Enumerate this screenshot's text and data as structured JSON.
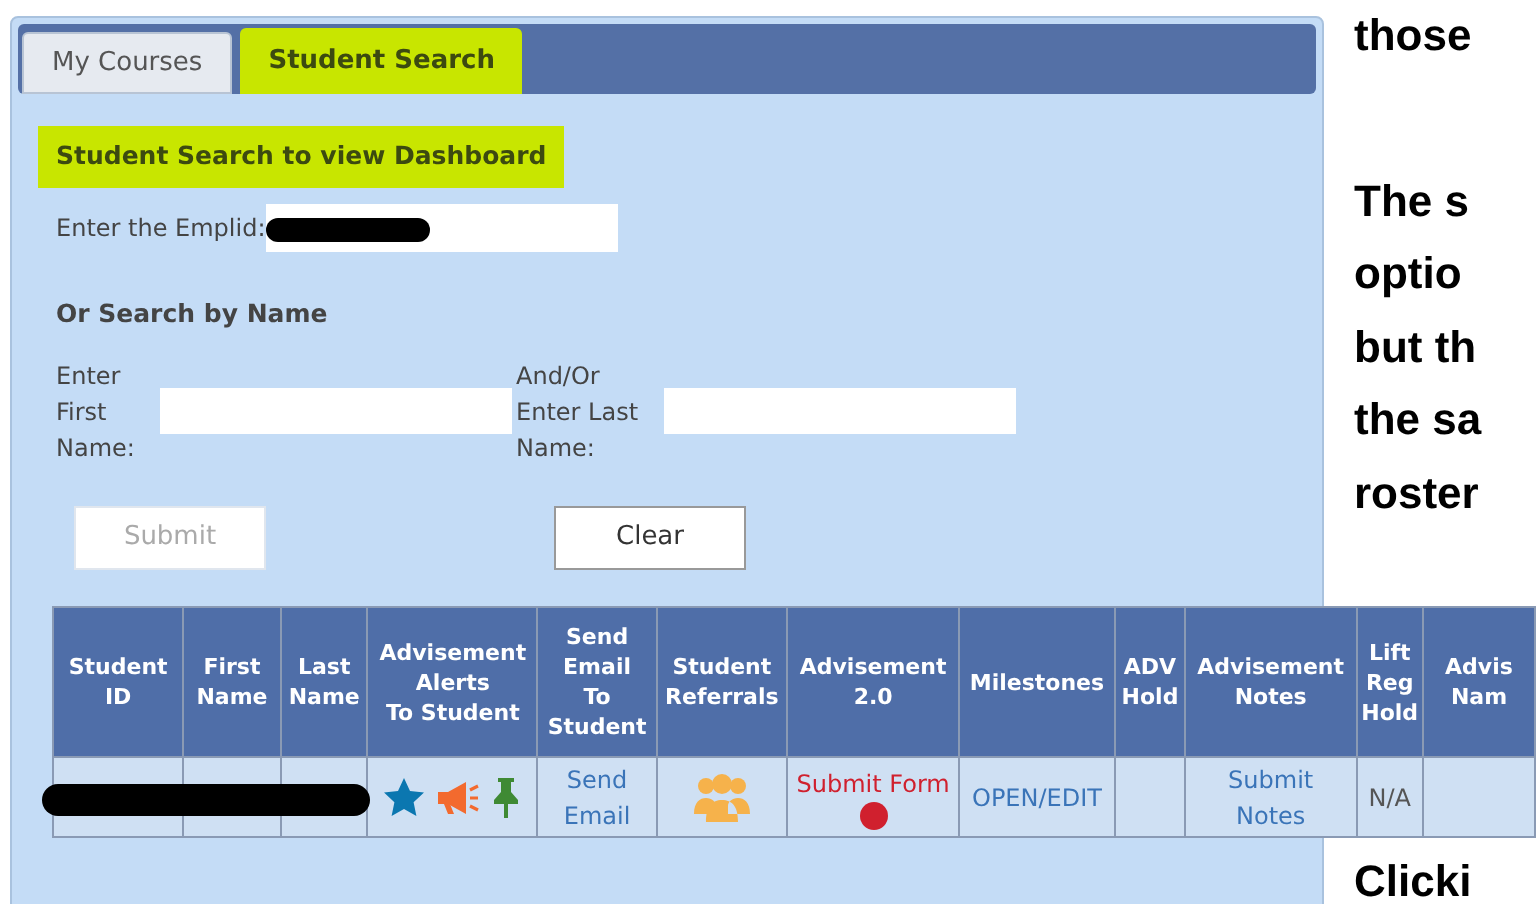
{
  "tabs": [
    {
      "label": "My Courses",
      "selected": false
    },
    {
      "label": "Student Search",
      "selected": true
    }
  ],
  "heading": "Student Search to view Dashboard",
  "emplid": {
    "label": "Enter the Emplid:",
    "redacted": true
  },
  "name_search": {
    "title": "Or Search by Name",
    "first_label": "Enter First Name:",
    "last_label": "And/Or Enter Last Name:"
  },
  "buttons": [
    {
      "label": "Submit",
      "disabled": true
    },
    {
      "label": "Clear",
      "disabled": false
    }
  ],
  "table": {
    "columns": [
      "Student\nID",
      "First\nName",
      "Last\nName",
      "Advisement\nAlerts\nTo Student",
      "Send\nEmail\nTo\nStudent",
      "Student\nReferrals",
      "Advisement\n2.0",
      "Milestones",
      "ADV\nHold",
      "Advisement\nNotes",
      "Lift\nReg\nHold",
      "Advis\nNam"
    ],
    "rows": [
      {
        "cells": [
          {
            "kind": "redacted"
          },
          {
            "kind": "empty"
          },
          {
            "kind": "empty"
          },
          {
            "kind": "alerts"
          },
          {
            "kind": "link",
            "text": "Send\nEmail"
          },
          {
            "kind": "referrals"
          },
          {
            "kind": "form",
            "text": "Submit Form",
            "color": "#d0202e"
          },
          {
            "kind": "link",
            "text": "OPEN/EDIT"
          },
          {
            "kind": "empty"
          },
          {
            "kind": "link",
            "text": "Submit\nNotes"
          },
          {
            "kind": "text",
            "text": "N/A"
          },
          {
            "kind": "empty"
          }
        ]
      }
    ]
  },
  "side_text": [
    [
      "those"
    ],
    [
      "The s",
      "optio",
      "but th",
      "the sa",
      "roster"
    ],
    [
      "Clicki"
    ]
  ]
}
